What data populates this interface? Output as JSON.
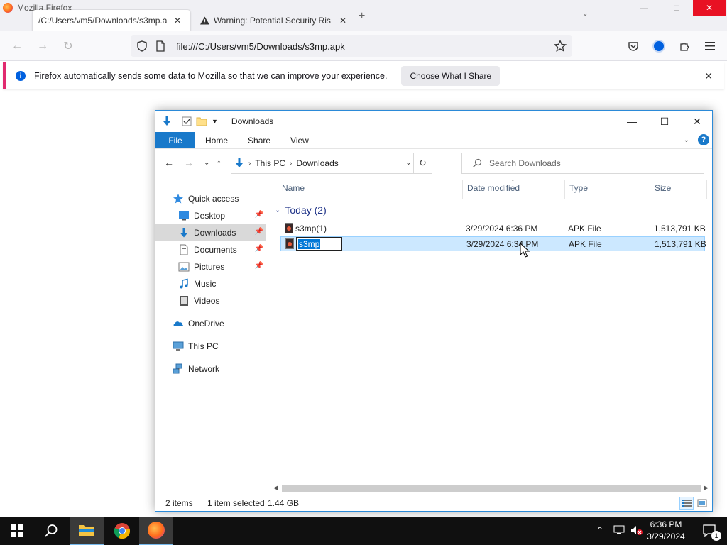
{
  "browser": {
    "app_title": "Mozilla Firefox",
    "tabs": [
      {
        "label": "/C:/Users/vm5/Downloads/s3mp.a"
      },
      {
        "label": "Warning: Potential Security Ris"
      }
    ],
    "url": "file:///C:/Users/vm5/Downloads/s3mp.apk",
    "notification": {
      "text": "Firefox automatically sends some data to Mozilla so that we can improve your experience.",
      "button": "Choose What I Share"
    },
    "accent_color": "#e12a6f"
  },
  "explorer": {
    "title": "Downloads",
    "ribbon_tabs": [
      "File",
      "Home",
      "Share",
      "View"
    ],
    "breadcrumb": [
      "This PC",
      "Downloads"
    ],
    "search_placeholder": "Search Downloads",
    "nav": {
      "quick_access": "Quick access",
      "items": [
        {
          "label": "Desktop",
          "icon": "desktop-icon",
          "pinned": true
        },
        {
          "label": "Downloads",
          "icon": "downloads-icon",
          "pinned": true
        },
        {
          "label": "Documents",
          "icon": "documents-icon",
          "pinned": true
        },
        {
          "label": "Pictures",
          "icon": "pictures-icon",
          "pinned": true
        },
        {
          "label": "Music",
          "icon": "music-icon",
          "pinned": false
        },
        {
          "label": "Videos",
          "icon": "videos-icon",
          "pinned": false
        }
      ],
      "onedrive": "OneDrive",
      "this_pc": "This PC",
      "network": "Network"
    },
    "columns": [
      "Name",
      "Date modified",
      "Type",
      "Size"
    ],
    "group": "Today (2)",
    "files": [
      {
        "name": "s3mp(1)",
        "date": "3/29/2024 6:36 PM",
        "type": "APK File",
        "size": "1,513,791 KB"
      },
      {
        "name": "s3mp",
        "date": "3/29/2024 6:34 PM",
        "type": "APK File",
        "size": "1,513,791 KB"
      }
    ],
    "status": {
      "count": "2 items",
      "selected": "1 item selected",
      "size": "1.44 GB"
    },
    "accent_color": "#1979ca"
  },
  "taskbar": {
    "time": "6:36 PM",
    "date": "3/29/2024",
    "notification_count": "1"
  }
}
